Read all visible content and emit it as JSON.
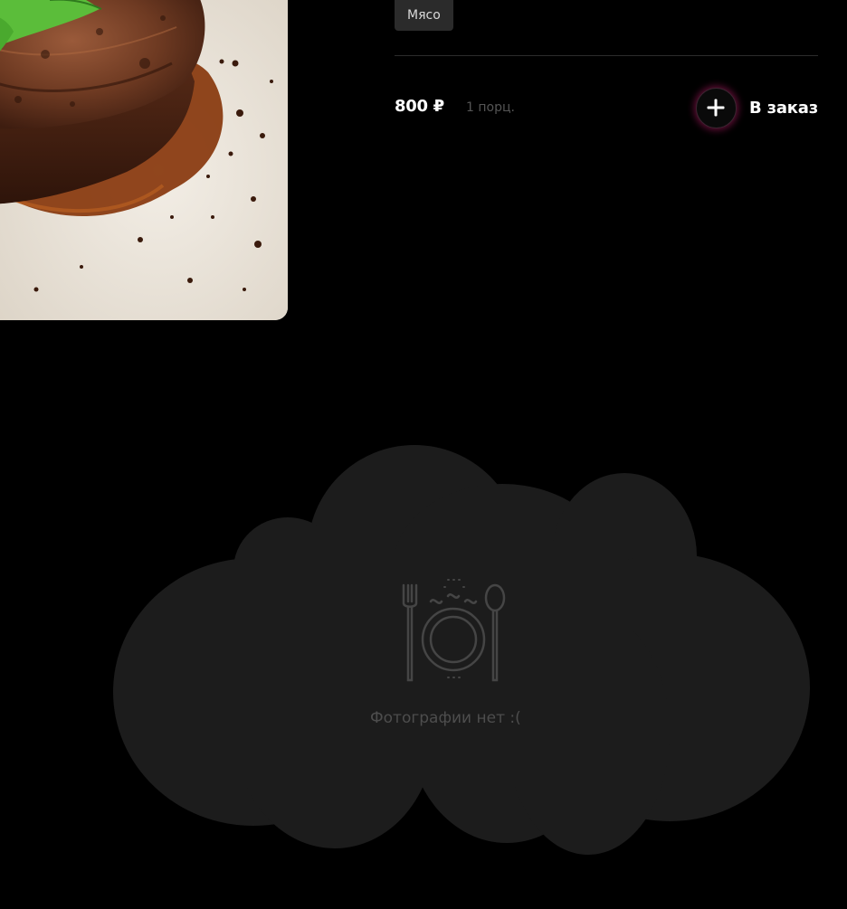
{
  "dish": {
    "category_tag": "Мясо",
    "price": "800 ₽",
    "portion": "1 порц.",
    "order_label": "В заказ"
  },
  "placeholder": {
    "text": "Фотографии нет :(",
    "icon": "plate-fork-spoon-icon"
  },
  "colors": {
    "background": "#000000",
    "card": "#1c1c1c",
    "accent_glow": "#d61e78",
    "muted_text": "#555555"
  }
}
